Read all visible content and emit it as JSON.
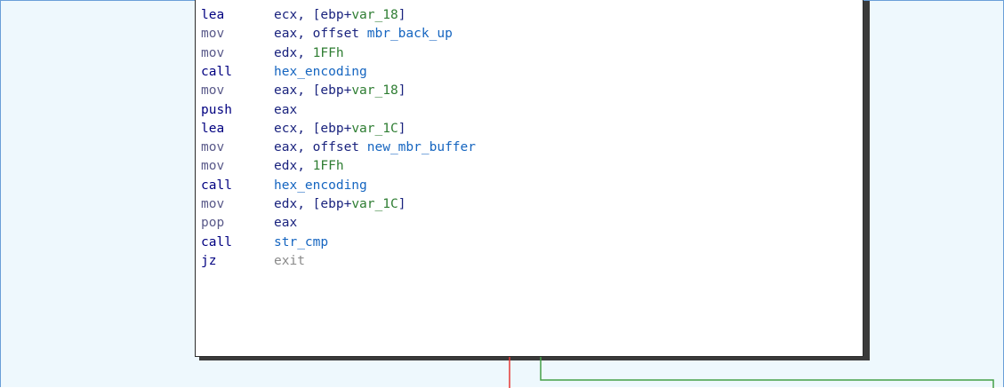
{
  "code_block": {
    "lines": [
      {
        "mnemonic": "lea",
        "tokens": [
          {
            "t": "ecx, [ebp+",
            "c": "kw"
          },
          {
            "t": "var_18",
            "c": "var"
          },
          {
            "t": "]",
            "c": "kw"
          }
        ]
      },
      {
        "mnemonic": "mov",
        "tokens": [
          {
            "t": "eax, offset ",
            "c": "kw"
          },
          {
            "t": "mbr_back_up",
            "c": "name"
          }
        ]
      },
      {
        "mnemonic": "mov",
        "tokens": [
          {
            "t": "edx, ",
            "c": "kw"
          },
          {
            "t": "1FFh",
            "c": "num"
          }
        ]
      },
      {
        "mnemonic": "call",
        "tokens": [
          {
            "t": "hex_encoding",
            "c": "name"
          }
        ]
      },
      {
        "mnemonic": "mov",
        "tokens": [
          {
            "t": "eax, [ebp+",
            "c": "kw"
          },
          {
            "t": "var_18",
            "c": "var"
          },
          {
            "t": "]",
            "c": "kw"
          }
        ]
      },
      {
        "mnemonic": "push",
        "tokens": [
          {
            "t": "eax",
            "c": "kw"
          }
        ]
      },
      {
        "mnemonic": "lea",
        "tokens": [
          {
            "t": "ecx, [ebp+",
            "c": "kw"
          },
          {
            "t": "var_1C",
            "c": "var"
          },
          {
            "t": "]",
            "c": "kw"
          }
        ]
      },
      {
        "mnemonic": "mov",
        "tokens": [
          {
            "t": "eax, offset ",
            "c": "kw"
          },
          {
            "t": "new_mbr_buffer",
            "c": "name"
          }
        ]
      },
      {
        "mnemonic": "mov",
        "tokens": [
          {
            "t": "edx, ",
            "c": "kw"
          },
          {
            "t": "1FFh",
            "c": "num"
          }
        ]
      },
      {
        "mnemonic": "call",
        "tokens": [
          {
            "t": "hex_encoding",
            "c": "name"
          }
        ]
      },
      {
        "mnemonic": "mov",
        "tokens": [
          {
            "t": "edx, [ebp+",
            "c": "kw"
          },
          {
            "t": "var_1C",
            "c": "var"
          },
          {
            "t": "]",
            "c": "kw"
          }
        ]
      },
      {
        "mnemonic": "pop",
        "tokens": [
          {
            "t": "eax",
            "c": "kw"
          }
        ]
      },
      {
        "mnemonic": "call",
        "tokens": [
          {
            "t": "str_cmp",
            "c": "name"
          }
        ]
      },
      {
        "mnemonic": "jz",
        "tokens": [
          {
            "t": "exit",
            "c": "exit"
          }
        ]
      }
    ]
  },
  "colors": {
    "background": "#eef8fd",
    "false_edge": "#e53935",
    "true_edge": "#43a047",
    "mnemonic": "#000080",
    "name": "#1565c0",
    "variable": "#2e7d32"
  }
}
